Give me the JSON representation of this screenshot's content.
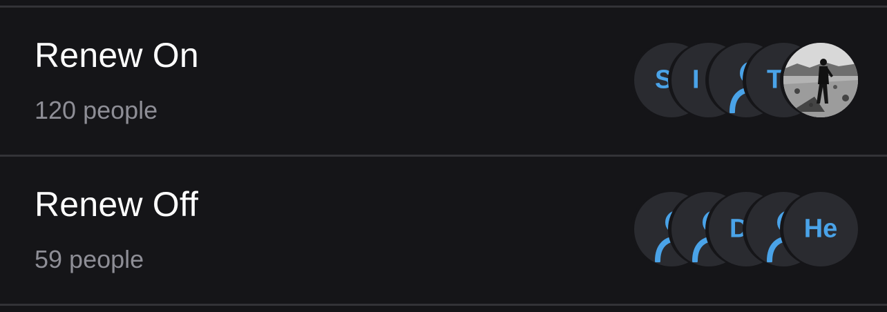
{
  "groups": [
    {
      "title": "Renew On",
      "count_text": "120 people",
      "avatars": [
        {
          "kind": "initials",
          "text": "S"
        },
        {
          "kind": "initials",
          "text": "I"
        },
        {
          "kind": "icon",
          "icon": "person-icon"
        },
        {
          "kind": "initials",
          "text": "T"
        },
        {
          "kind": "photo",
          "icon": "profile-photo"
        }
      ]
    },
    {
      "title": "Renew Off",
      "count_text": "59 people",
      "avatars": [
        {
          "kind": "icon",
          "icon": "person-icon"
        },
        {
          "kind": "icon",
          "icon": "person-icon"
        },
        {
          "kind": "initials",
          "text": "D"
        },
        {
          "kind": "icon",
          "icon": "person-icon"
        },
        {
          "kind": "initials",
          "text": "He"
        }
      ]
    }
  ],
  "colors": {
    "background": "#151518",
    "divider": "#333337",
    "title": "#ffffff",
    "subtitle": "#8e8e96",
    "avatar_bg": "#2a2b30",
    "accent": "#4aa3e8"
  }
}
